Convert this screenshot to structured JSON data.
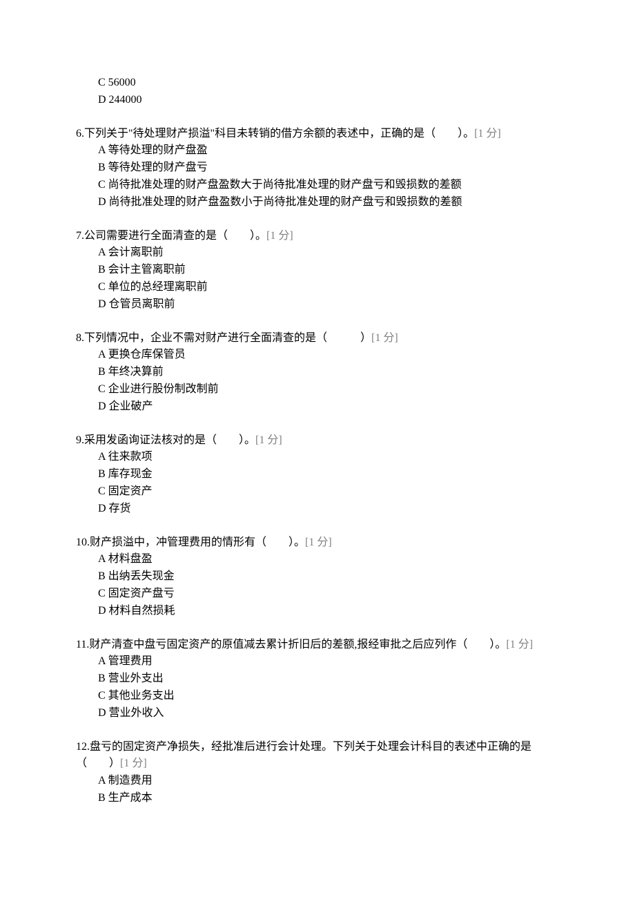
{
  "continued_options": [
    "C 56000",
    "D 244000"
  ],
  "questions": [
    {
      "stem_prefix": "6.下列关于\"待处理财产损溢\"科目未转销的借方余额的表述中，正确的是（　　）。",
      "points": "[1 分]",
      "options": [
        "A 等待处理的财产盘盈",
        "B 等待处理的财产盘亏",
        "C 尚待批准处理的财产盘盈数大于尚待批准处理的财产盘亏和毁损数的差额",
        "D 尚待批准处理的财产盘盈数小于尚待批准处理的财产盘亏和毁损数的差额"
      ]
    },
    {
      "stem_prefix": "7.公司需要进行全面清查的是（　　）。",
      "points": "[1 分]",
      "options": [
        "A 会计离职前",
        "B 会计主管离职前",
        "C 单位的总经理离职前",
        "D 仓管员离职前"
      ]
    },
    {
      "stem_prefix": "8.下列情况中，企业不需对财产进行全面清查的是（　　　）",
      "points": "[1 分]",
      "options": [
        "A 更换仓库保管员",
        "B 年终决算前",
        "C 企业进行股份制改制前",
        "D 企业破产"
      ]
    },
    {
      "stem_prefix": "9.采用发函询证法核对的是（　　）。",
      "points": "[1 分]",
      "options": [
        "A 往来款项",
        "B 库存现金",
        "C 固定资产",
        "D 存货"
      ]
    },
    {
      "stem_prefix": "10.财产损溢中，冲管理费用的情形有（　　）。",
      "points": "[1 分]",
      "options": [
        "A 材料盘盈",
        "B 出纳丢失现金",
        "C 固定资产盘亏",
        "D 材料自然损耗"
      ]
    },
    {
      "stem_prefix": "11.财产清查中盘亏固定资产的原值减去累计折旧后的差额,报经审批之后应列作（　　）。",
      "points": "[1 分]",
      "options": [
        "A 管理费用",
        "B 营业外支出",
        "C 其他业务支出",
        "D 营业外收入"
      ]
    },
    {
      "stem_prefix": "12.盘亏的固定资产净损失，经批准后进行会计处理。下列关于处理会计科目的表述中正确的是（　　）",
      "points": "[1 分]",
      "options": [
        "A 制造费用",
        "B 生产成本"
      ]
    }
  ]
}
